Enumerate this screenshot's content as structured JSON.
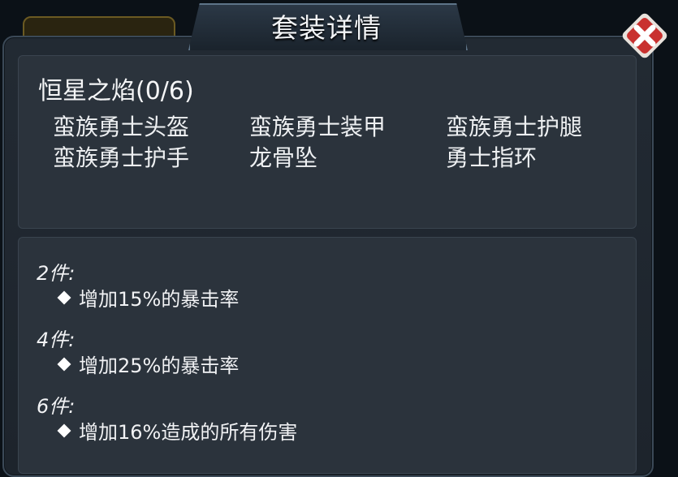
{
  "dialog": {
    "title": "套装详情",
    "close_icon": "close-icon"
  },
  "set": {
    "name": "恒星之焰(0/6)",
    "pieces": [
      "蛮族勇士头盔",
      "蛮族勇士装甲",
      "蛮族勇士护腿",
      "蛮族勇士护手",
      "龙骨坠",
      "勇士指环"
    ]
  },
  "bonuses": [
    {
      "tier": "2件:",
      "effect": "增加15%的暴击率"
    },
    {
      "tier": "4件:",
      "effect": "增加25%的暴击率"
    },
    {
      "tier": "6件:",
      "effect": "增加16%造成的所有伤害"
    }
  ],
  "colors": {
    "close_button": "#c9312f",
    "panel_border": "#3b4957",
    "text": "#f1f2f4"
  }
}
